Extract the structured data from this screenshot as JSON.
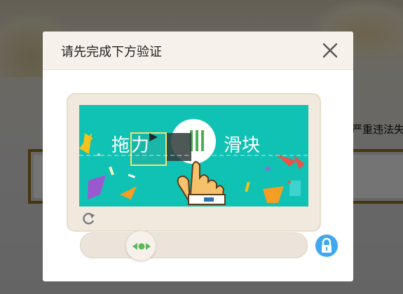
{
  "background": {
    "partial_text": "严重违法失"
  },
  "modal": {
    "title": "请先完成下方验证",
    "close_icon": "close-icon"
  },
  "captcha": {
    "image_text_left": "拖动",
    "image_text_right": "滑块",
    "refresh_icon": "refresh-icon",
    "slider_handle_icon": "arrows-left-right-icon",
    "lock_icon": "lock-icon",
    "slider_progress": 0.0
  },
  "colors": {
    "puzzle_bg": "#10c2b3",
    "lock_blue": "#3fa8ef",
    "panel_beige": "#f1e9dd",
    "header_bg": "#f6f1ea",
    "handle_green": "#5cb85c"
  }
}
